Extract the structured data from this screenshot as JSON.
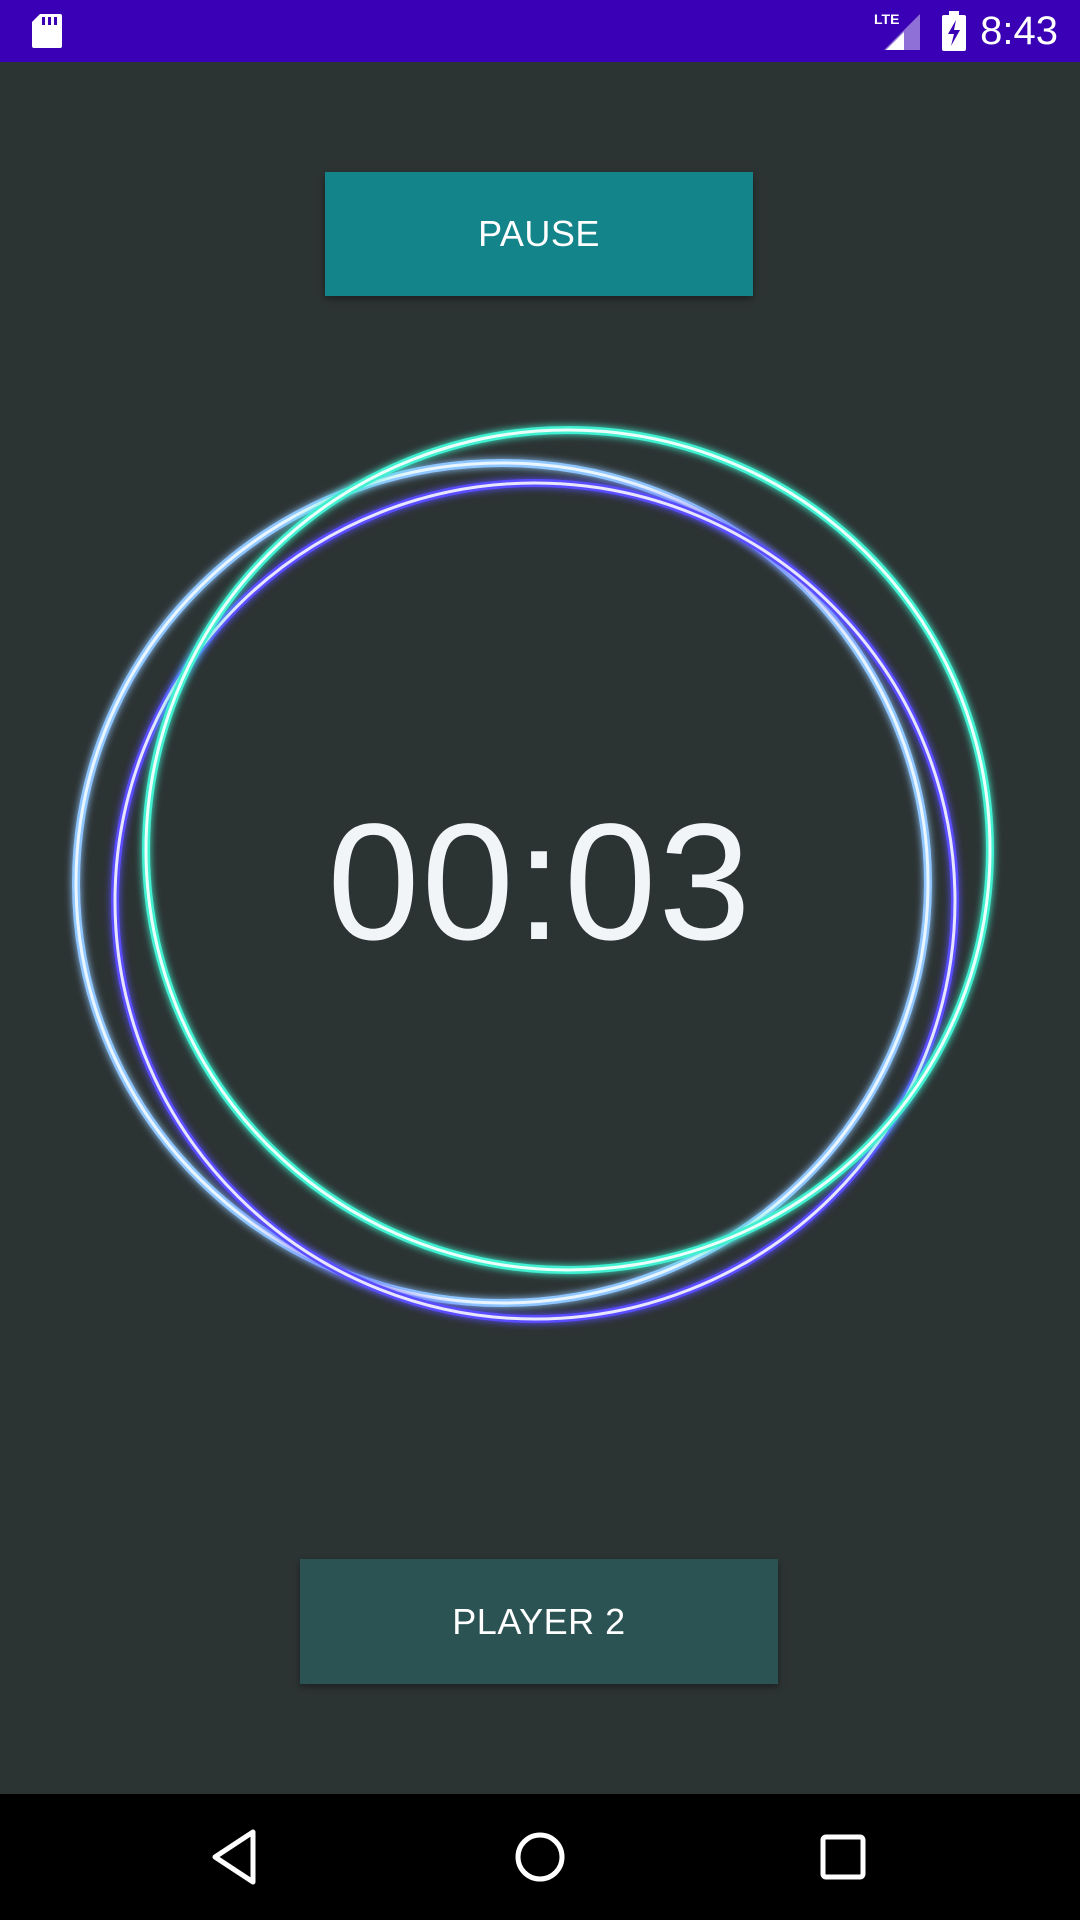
{
  "status_bar": {
    "time": "8:43",
    "network_label": "LTE",
    "icons": [
      "sd-card-icon",
      "lte-signal-icon",
      "battery-charging-icon"
    ],
    "background_color": "#3a00b5"
  },
  "controls": {
    "pause_label": "PAUSE",
    "player_label": "PLAYER 2",
    "pause_color": "#12848a",
    "player_color": "#2c5354"
  },
  "timer": {
    "display": "00:03"
  },
  "rings": {
    "colors": [
      "#7fffe0",
      "#cfe8ff",
      "#8a8cff"
    ]
  },
  "nav_bar": {
    "icons": [
      "back-icon",
      "home-icon",
      "recents-icon"
    ]
  },
  "theme": {
    "background": "#2c3333"
  }
}
